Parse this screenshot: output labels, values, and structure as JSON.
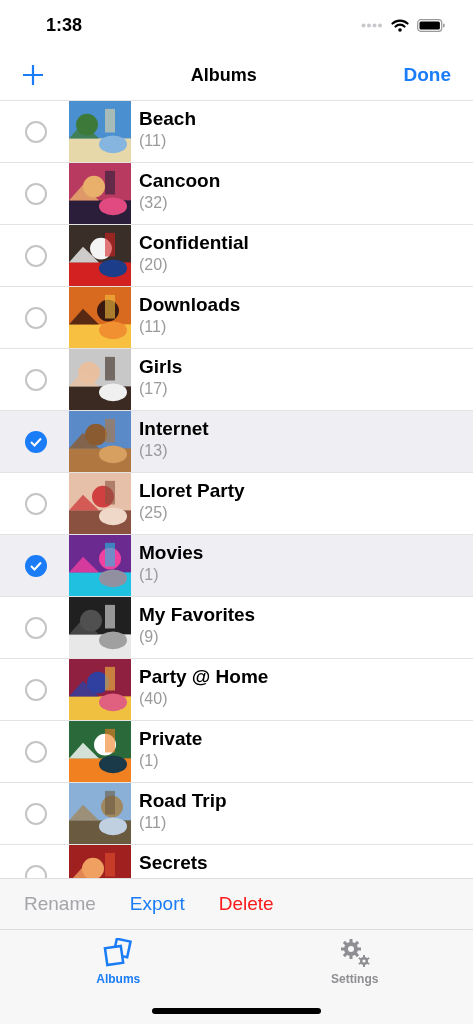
{
  "status_bar": {
    "time": "1:38"
  },
  "nav": {
    "title": "Albums",
    "right": "Done"
  },
  "albums": [
    {
      "name": "Beach",
      "count": "(11)",
      "selected": false
    },
    {
      "name": "Cancoon",
      "count": "(32)",
      "selected": false
    },
    {
      "name": "Confidential",
      "count": "(20)",
      "selected": false
    },
    {
      "name": "Downloads",
      "count": "(11)",
      "selected": false
    },
    {
      "name": "Girls",
      "count": "(17)",
      "selected": false
    },
    {
      "name": "Internet",
      "count": "(13)",
      "selected": true
    },
    {
      "name": "Lloret Party",
      "count": "(25)",
      "selected": false
    },
    {
      "name": "Movies",
      "count": "(1)",
      "selected": true
    },
    {
      "name": "My Favorites",
      "count": "(9)",
      "selected": false
    },
    {
      "name": "Party @ Home",
      "count": "(40)",
      "selected": false
    },
    {
      "name": "Private",
      "count": "(1)",
      "selected": false
    },
    {
      "name": "Road Trip",
      "count": "(11)",
      "selected": false
    },
    {
      "name": "Secrets",
      "selected": false
    }
  ],
  "toolbar": [
    {
      "label": "Rename",
      "kind": "plain",
      "disabled": true
    },
    {
      "label": "Export",
      "kind": "plain",
      "disabled": false
    },
    {
      "label": "Delete",
      "kind": "destructive",
      "disabled": false
    }
  ],
  "tabs": [
    {
      "label": "Albums",
      "kind": "albums",
      "selected": true
    },
    {
      "label": "Settings",
      "kind": "settings",
      "selected": false
    }
  ]
}
